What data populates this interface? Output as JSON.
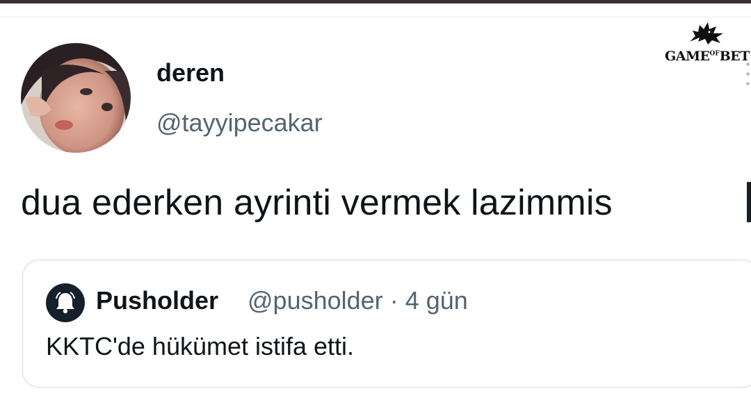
{
  "tweet": {
    "display_name": "deren",
    "handle": "@tayyipecakar",
    "text": "dua ederken ayrinti vermek lazimmis"
  },
  "quoted_tweet": {
    "display_name": "Pusholder",
    "handle": "@pusholder",
    "separator": "·",
    "time": "4 gün",
    "text": "KKTC'de hükümet istifa etti."
  },
  "watermark": {
    "text_left": "GAME",
    "text_of": "OF",
    "text_right": "BET"
  },
  "icons": {
    "avatar": "user-avatar",
    "quoted_avatar": "bell-icon",
    "more": "more-icon",
    "watermark_crest": "wolf-crest-icon"
  },
  "colors": {
    "text_primary": "#0f1419",
    "text_secondary": "#536471",
    "border": "#cfd9de",
    "quoted_avatar_bg": "#15202b"
  }
}
